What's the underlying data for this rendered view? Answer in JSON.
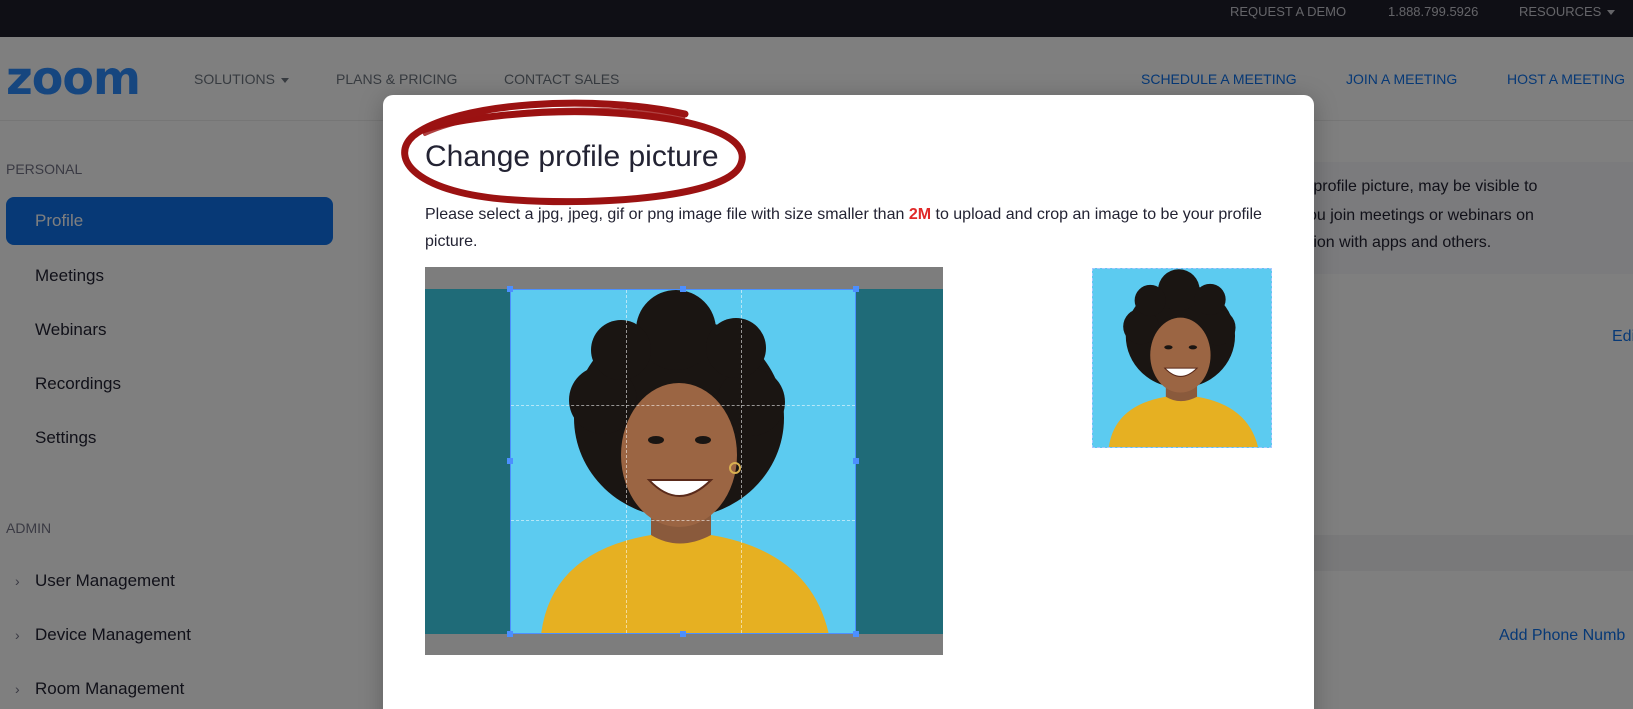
{
  "topbar": {
    "request_demo": "REQUEST A DEMO",
    "phone": "1.888.799.5926",
    "resources": "RESOURCES"
  },
  "nav": {
    "logo": "zoom",
    "solutions": "SOLUTIONS",
    "plans": "PLANS & PRICING",
    "contact": "CONTACT SALES",
    "schedule": "SCHEDULE A MEETING",
    "join": "JOIN A MEETING",
    "host": "HOST A MEETING"
  },
  "sidebar": {
    "personal_heading": "PERSONAL",
    "personal_items": [
      {
        "label": "Profile",
        "active": true
      },
      {
        "label": "Meetings"
      },
      {
        "label": "Webinars"
      },
      {
        "label": "Recordings"
      },
      {
        "label": "Settings"
      }
    ],
    "admin_heading": "ADMIN",
    "admin_items": [
      {
        "label": "User Management"
      },
      {
        "label": "Device Management"
      },
      {
        "label": "Room Management"
      }
    ]
  },
  "background": {
    "info_line1": "d profile picture, may be visible to",
    "info_line2": "you join meetings or webinars on",
    "info_line3": "ation with apps and others.",
    "edit_link": "Edi",
    "add_phone_link": "Add Phone Numb"
  },
  "modal": {
    "title": "Change profile picture",
    "instr_before": "Please select a jpg, jpeg, gif or png image file with size smaller than ",
    "instr_size": "2M",
    "instr_after": " to upload and crop an image to be your profile picture.",
    "annotation_color": "#9b1212"
  },
  "colors": {
    "accent": "#0e72ed",
    "topbar_bg": "#1f1f2b",
    "highlight_red": "#e02828"
  }
}
